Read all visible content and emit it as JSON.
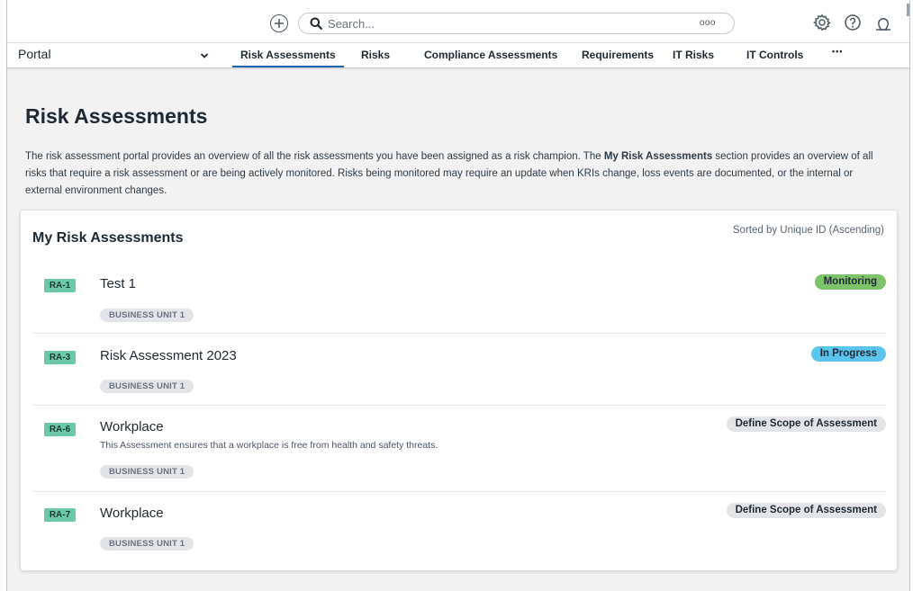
{
  "topbar": {
    "search_placeholder": "Search...",
    "search_options": "ooo",
    "icons": [
      "add-icon",
      "search-icon",
      "gear-icon",
      "help-icon",
      "user-icon"
    ]
  },
  "navbar": {
    "portal_label": "Portal",
    "tabs": [
      {
        "label": "Risk Assessments",
        "active": true
      },
      {
        "label": "Risks",
        "active": false
      },
      {
        "label": "Compliance Assessments",
        "active": false
      },
      {
        "label": "Requirements",
        "active": false
      },
      {
        "label": "IT Risks",
        "active": false
      },
      {
        "label": "IT Controls",
        "active": false
      },
      {
        "label": "•••",
        "active": false
      }
    ]
  },
  "page": {
    "title": "Risk Assessments",
    "intro_part1": "The risk assessment portal provides an overview of all the risk assessments you have been assigned as a risk champion. The ",
    "intro_bold": "My Risk Assessments",
    "intro_part2": " section provides an overview of all risks that require a risk assessment or are being actively monitored. Risks being monitored may require an update when KRIs change, loss events are documented, or the internal or external environment changes."
  },
  "card": {
    "title": "My Risk Assessments",
    "sorted_by": "Sorted by Unique ID (Ascending)",
    "items": [
      {
        "id": "RA-1",
        "title": "Test 1",
        "description": "",
        "unit": "BUSINESS UNIT 1",
        "status": "Monitoring",
        "status_color": "#7cc36a"
      },
      {
        "id": "RA-3",
        "title": "Risk Assessment 2023",
        "description": "",
        "unit": "BUSINESS UNIT 1",
        "status": "In Progress",
        "status_color": "#5bc4ec"
      },
      {
        "id": "RA-6",
        "title": "Workplace",
        "description": "This Assessment ensures that a workplace is free from health and safety threats.",
        "unit": "BUSINESS UNIT 1",
        "status": "Define Scope of Assessment",
        "status_color": "#e2e4e7"
      },
      {
        "id": "RA-7",
        "title": "Workplace",
        "description": "",
        "unit": "BUSINESS UNIT 1",
        "status": "Define Scope of Assessment",
        "status_color": "#e2e4e7"
      }
    ]
  },
  "colors": {
    "accent": "#2563b0",
    "id_badge": "#69c9a9"
  }
}
